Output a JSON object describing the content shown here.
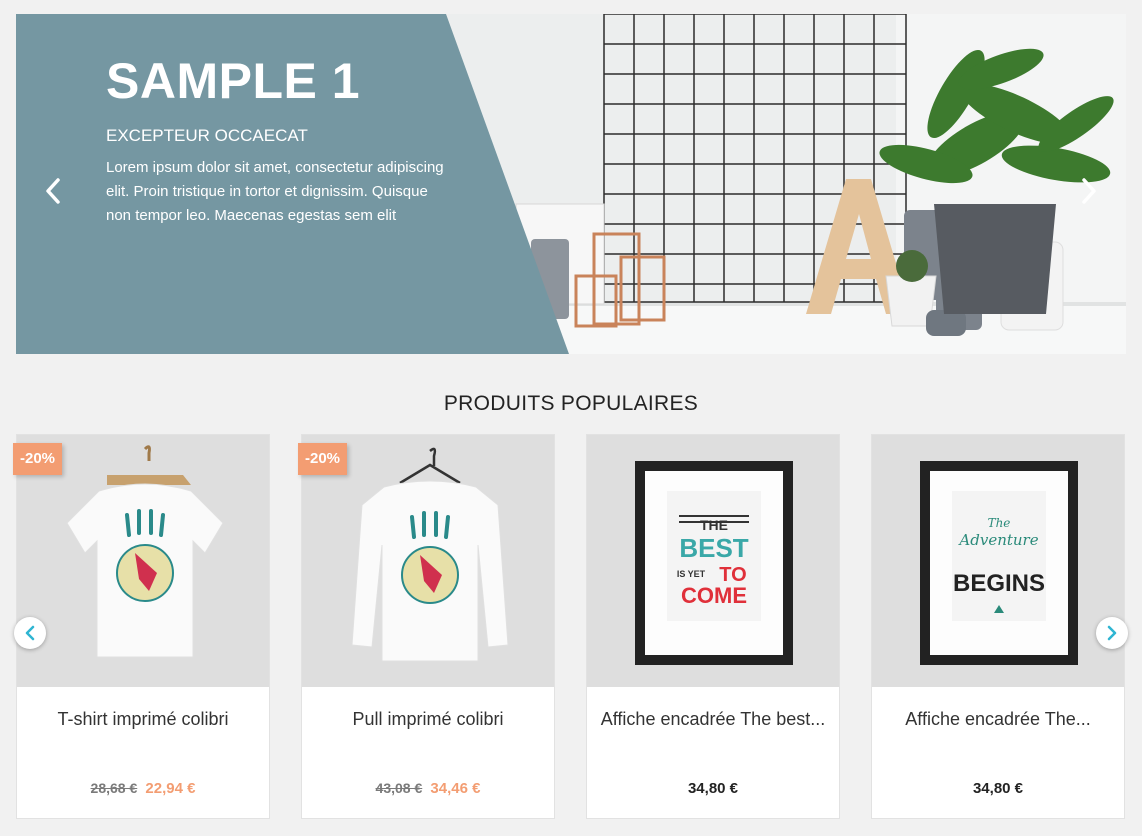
{
  "slider": {
    "title": "SAMPLE 1",
    "subtitle": "EXCEPTEUR OCCAECAT",
    "text": "Lorem ipsum dolor sit amet, consectetur adipiscing elit. Proin tristique in tortor et dignissim. Quisque non tempor leo. Maecenas egestas sem elit",
    "prev_icon": "chevron-left-icon",
    "next_icon": "chevron-right-icon"
  },
  "section": {
    "title": "PRODUITS POPULAIRES"
  },
  "products": [
    {
      "name": "T-shirt imprimé colibri",
      "old_price": "28,68 €",
      "price": "22,94 €",
      "badge": "-20%"
    },
    {
      "name": "Pull imprimé colibri",
      "old_price": "43,08 €",
      "price": "34,46 €",
      "badge": "-20%"
    },
    {
      "name": "Affiche encadrée The best...",
      "price": "34,80 €",
      "poster": {
        "l1": "THE",
        "l2": "BEST",
        "l3": "IS YET",
        "l4": "TO",
        "l5": "COME"
      }
    },
    {
      "name": "Affiche encadrée The...",
      "price": "34,80 €",
      "poster": {
        "l1": "The",
        "l2": "Adventure",
        "l3": "BEGINS"
      }
    }
  ],
  "colors": {
    "accent": "#f39d72",
    "panel": "#7597a2",
    "arrow": "#2fb5d2"
  }
}
